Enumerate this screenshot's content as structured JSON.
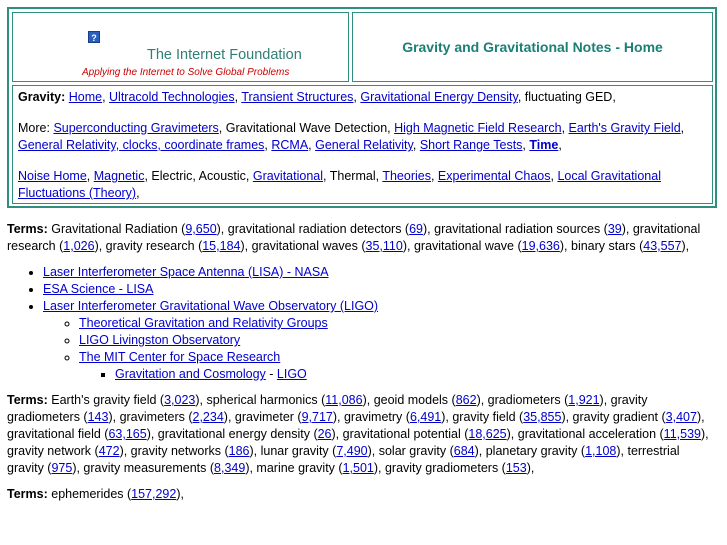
{
  "header": {
    "help_icon_label": "?",
    "foundation": "The Internet Foundation",
    "tagline": "Applying the Internet to Solve Global Problems",
    "title": "Gravity and Gravitational Notes - Home"
  },
  "nav": {
    "gravity_label": "Gravity:",
    "gravity_links": [
      "Home",
      "Ultracold Technologies",
      "Transient Structures",
      "Gravitational Energy Density"
    ],
    "gravity_tail": ", fluctuating GED,",
    "more_label": "More:",
    "more_link1": "Superconducting Gravimeters",
    "more_text1": ", Gravitational Wave Detection, ",
    "more_link2": "High Magnetic Field Research",
    "more_link3": "Earth's Gravity Field",
    "more_link4": "General Relativity, clocks, coordinate frames",
    "more_link5": "RCMA",
    "more_link6": "General Relativity",
    "more_link7": "Short Range Tests",
    "more_link8": "Time",
    "noise_home": "Noise Home",
    "magnetic": "Magnetic",
    "noise_text1": ", Electric, Acoustic, ",
    "gravitational": "Gravitational",
    "noise_text2": ", Thermal, ",
    "theories": "Theories",
    "experimental_chaos": "Experimental Chaos",
    "local_fluct": "Local Gravitational Fluctuations (Theory)"
  },
  "terms1": {
    "label": "Terms:",
    "items": [
      {
        "term": "Gravitational Radiation",
        "count": "9,650"
      },
      {
        "term": "gravitational radiation detectors",
        "count": "69"
      },
      {
        "term": "gravitational radiation sources",
        "count": "39"
      },
      {
        "term": "gravitational research",
        "count": "1,026"
      },
      {
        "term": "gravity research",
        "count": "15,184"
      },
      {
        "term": "gravitational waves",
        "count": "35,110"
      },
      {
        "term": "gravitational wave",
        "count": "19,636"
      },
      {
        "term": "binary stars",
        "count": "43,557"
      }
    ]
  },
  "links": {
    "lisa": "Laser Interferometer Space Antenna (LISA) - NASA",
    "esa": "ESA Science - LISA",
    "ligo": "Laser Interferometer Gravitational Wave Observatory (LIGO)",
    "theoretical": "Theoretical Gravitation and Relativity Groups",
    "livingston": "LIGO Livingston Observatory",
    "mit": "The MIT Center for Space Research",
    "cosmology": "Gravitation and Cosmology",
    "cosmology_sep": " - ",
    "cosmology_ligo": "LIGO"
  },
  "terms2": {
    "label": "Terms:",
    "items": [
      {
        "term": "Earth's gravity field",
        "count": "3,023"
      },
      {
        "term": "spherical harmonics",
        "count": "11,086"
      },
      {
        "term": "geoid models",
        "count": "862"
      },
      {
        "term": "gradiometers",
        "count": "1,921"
      },
      {
        "term": "gravity gradiometers",
        "count": "143"
      },
      {
        "term": "gravimeters",
        "count": "2,234"
      },
      {
        "term": "gravimeter",
        "count": "9,717"
      },
      {
        "term": "gravimetry",
        "count": "6,491"
      },
      {
        "term": "gravity field",
        "count": "35,855"
      },
      {
        "term": "gravity gradient",
        "count": "3,407"
      },
      {
        "term": "gravitational field",
        "count": "63,165"
      },
      {
        "term": "gravitational energy density",
        "count": "26"
      },
      {
        "term": "gravitational potential",
        "count": "18,625"
      },
      {
        "term": "gravitational acceleration",
        "count": "11,539"
      },
      {
        "term": "gravity network",
        "count": "472"
      },
      {
        "term": "gravity networks",
        "count": "186"
      },
      {
        "term": "lunar gravity",
        "count": "7,490"
      },
      {
        "term": "solar gravity",
        "count": "684"
      },
      {
        "term": "planetary gravity",
        "count": "1,108"
      },
      {
        "term": "terrestrial gravity",
        "count": "975"
      },
      {
        "term": "gravity measurements",
        "count": "8,349"
      },
      {
        "term": "marine gravity",
        "count": "1,501"
      },
      {
        "term": "gravity gradiometers",
        "count": "153"
      }
    ]
  },
  "terms3": {
    "label": "Terms:",
    "items": [
      {
        "term": "ephemerides",
        "count": "157,292"
      }
    ]
  }
}
